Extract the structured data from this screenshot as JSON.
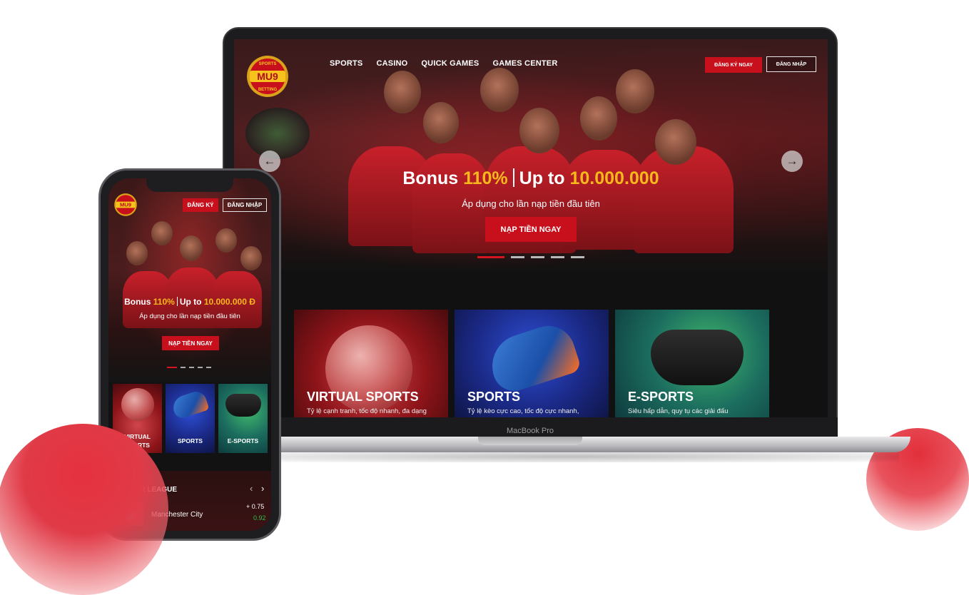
{
  "laptop": {
    "brand_label": "MacBook Pro",
    "logo": {
      "top_text": "SPORTS",
      "main_text": "MU9",
      "bottom_text": "BETTING"
    },
    "nav": [
      "SPORTS",
      "CASINO",
      "QUICK GAMES",
      "GAMES CENTER"
    ],
    "register_label": "ĐĂNG KÝ NGAY",
    "login_label": "ĐĂNG NHẬP",
    "hero": {
      "bonus_prefix": "Bonus ",
      "bonus_percent": "110%",
      "upto_prefix": "Up to ",
      "upto_amount": "10.000.000",
      "subtitle": "Áp dụng cho lần nạp tiền đầu tiên",
      "cta_label": "NẠP TIỀN NGAY",
      "slide_count": 5,
      "active_slide": 1
    },
    "cards": [
      {
        "title": "VIRTUAL SPORTS",
        "desc": "Tỷ lệ cạnh tranh, tốc độ nhanh, đa dạng"
      },
      {
        "title": "SPORTS",
        "desc": "Tỷ lệ kèo cực cao, tốc độ cực nhanh,"
      },
      {
        "title": "E-SPORTS",
        "desc": "Siêu hấp dẫn, quy tụ các giải đấu"
      }
    ]
  },
  "phone": {
    "register_label": "ĐĂNG KÝ",
    "login_label": "ĐĂNG NHẬP",
    "hero": {
      "bonus_prefix": "Bonus ",
      "bonus_percent": "110%",
      "upto_prefix": "Up to ",
      "upto_amount": "10.000.000 Đ",
      "subtitle": "Áp dụng cho lần nạp tiền đầu tiên",
      "cta_label": "NẠP TIỀN NGAY"
    },
    "cards": [
      {
        "title": "VIRTUAL SPORTS"
      },
      {
        "title": "SPORTS"
      },
      {
        "title": "E-SPORTS"
      }
    ],
    "league": {
      "title": "PREMIER LEAGUE",
      "team": "Manchester City",
      "handicap": "+ 0.75",
      "odds": "0.92"
    }
  },
  "colors": {
    "accent_red": "#c8101d",
    "gold": "#f7b81c",
    "odds_green": "#2fbe4f"
  }
}
